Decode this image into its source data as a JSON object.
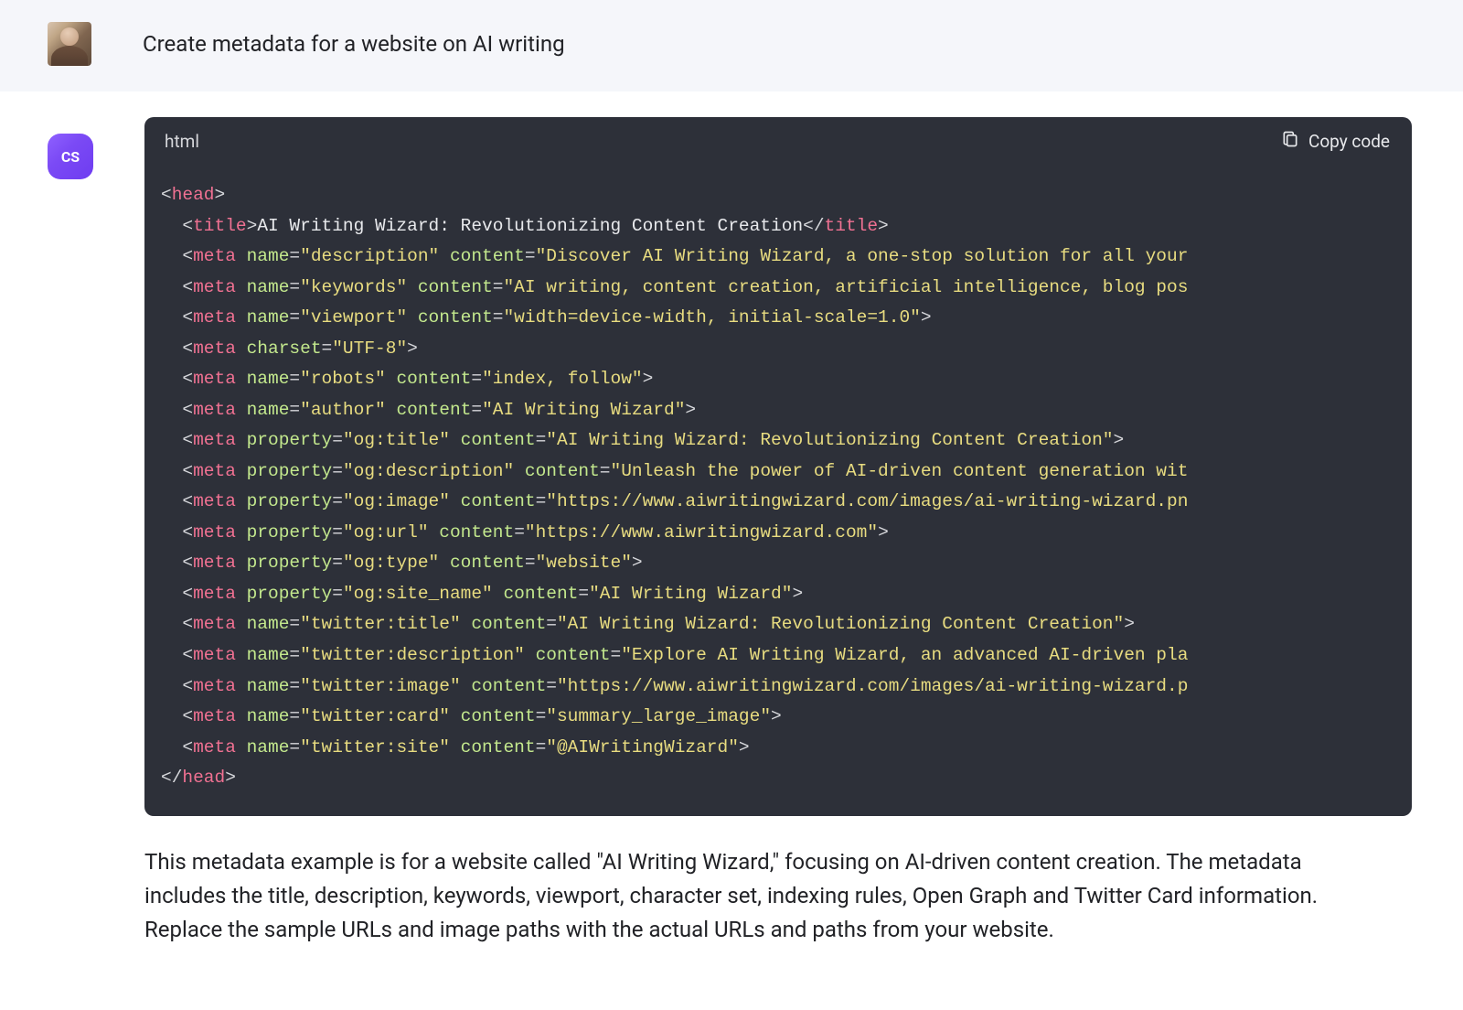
{
  "user": {
    "prompt": "Create metadata for a website on AI writing"
  },
  "assistant": {
    "avatar_label": "CS",
    "explanation": "This metadata example is for a website called \"AI Writing Wizard,\" focusing on AI-driven content creation. The metadata includes the title, description, keywords, viewport, character set, indexing rules, Open Graph and Twitter Card information. Replace the sample URLs and image paths with the actual URLs and paths from your website."
  },
  "code": {
    "language": "html",
    "copy_label": "Copy code",
    "title_text": "AI Writing Wizard: Revolutionizing Content Creation",
    "lines": [
      {
        "attr": "name",
        "attrVal": "description",
        "content": "Discover AI Writing Wizard, a one-stop solution for all your"
      },
      {
        "attr": "name",
        "attrVal": "keywords",
        "content": "AI writing, content creation, artificial intelligence, blog pos"
      },
      {
        "attr": "name",
        "attrVal": "viewport",
        "content": "width=device-width, initial-scale=1.0",
        "closed": true
      },
      {
        "charset": "UTF-8"
      },
      {
        "attr": "name",
        "attrVal": "robots",
        "content": "index, follow",
        "closed": true
      },
      {
        "attr": "name",
        "attrVal": "author",
        "content": "AI Writing Wizard",
        "closed": true
      },
      {
        "attr": "property",
        "attrVal": "og:title",
        "content": "AI Writing Wizard: Revolutionizing Content Creation",
        "closed": true
      },
      {
        "attr": "property",
        "attrVal": "og:description",
        "content": "Unleash the power of AI-driven content generation wit"
      },
      {
        "attr": "property",
        "attrVal": "og:image",
        "content": "https://www.aiwritingwizard.com/images/ai-writing-wizard.pn"
      },
      {
        "attr": "property",
        "attrVal": "og:url",
        "content": "https://www.aiwritingwizard.com",
        "closed": true
      },
      {
        "attr": "property",
        "attrVal": "og:type",
        "content": "website",
        "closed": true
      },
      {
        "attr": "property",
        "attrVal": "og:site_name",
        "content": "AI Writing Wizard",
        "closed": true
      },
      {
        "attr": "name",
        "attrVal": "twitter:title",
        "content": "AI Writing Wizard: Revolutionizing Content Creation",
        "closed": true
      },
      {
        "attr": "name",
        "attrVal": "twitter:description",
        "content": "Explore AI Writing Wizard, an advanced AI-driven pla"
      },
      {
        "attr": "name",
        "attrVal": "twitter:image",
        "content": "https://www.aiwritingwizard.com/images/ai-writing-wizard.p"
      },
      {
        "attr": "name",
        "attrVal": "twitter:card",
        "content": "summary_large_image",
        "closed": true
      },
      {
        "attr": "name",
        "attrVal": "twitter:site",
        "content": "@AIWritingWizard",
        "closed": true
      }
    ]
  }
}
